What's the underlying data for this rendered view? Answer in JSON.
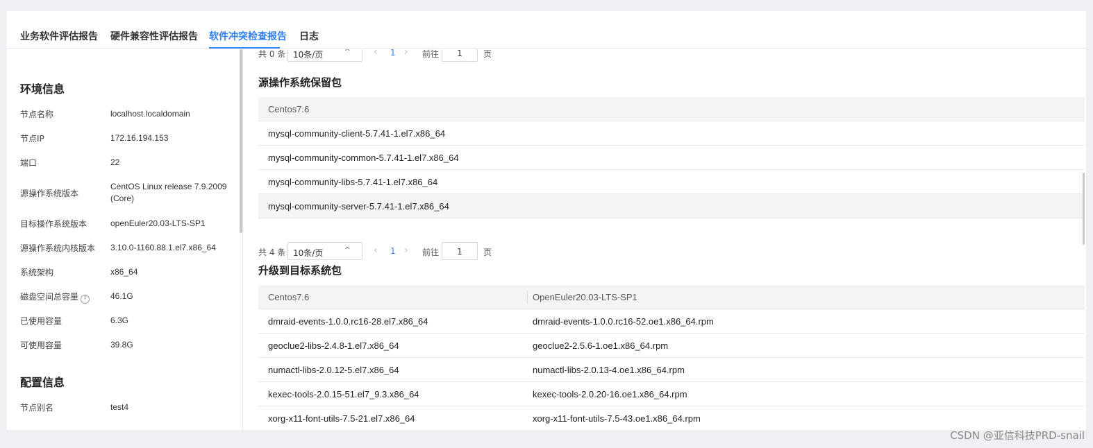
{
  "tabs": [
    {
      "label": "业务软件评估报告"
    },
    {
      "label": "硬件兼容性评估报告"
    },
    {
      "label": "软件冲突检查报告"
    },
    {
      "label": "日志"
    }
  ],
  "env": {
    "title": "环境信息",
    "rows": [
      {
        "label": "节点名称",
        "value": "localhost.localdomain"
      },
      {
        "label": "节点IP",
        "value": "172.16.194.153"
      },
      {
        "label": "端口",
        "value": "22"
      },
      {
        "label": "源操作系统版本",
        "value": "CentOS Linux release 7.9.2009 (Core)"
      },
      {
        "label": "目标操作系统版本",
        "value": "openEuler20.03-LTS-SP1"
      },
      {
        "label": "源操作系统内核版本",
        "value": "3.10.0-1160.88.1.el7.x86_64"
      },
      {
        "label": "系统架构",
        "value": "x86_64"
      },
      {
        "label": "磁盘空间总容量",
        "value": "46.1G",
        "help_icon": "?"
      },
      {
        "label": "已使用容量",
        "value": "6.3G"
      },
      {
        "label": "可使用容量",
        "value": "39.8G"
      }
    ]
  },
  "config": {
    "title": "配置信息",
    "rows": [
      {
        "label": "节点别名",
        "value": "test4"
      }
    ]
  },
  "pager_top": {
    "total": "共 0 条",
    "size": "10条/页",
    "chevron": "^",
    "prev": "‹",
    "page": "1",
    "next": "›",
    "goto": "前往",
    "goto_value": "1",
    "unit": "页"
  },
  "retained": {
    "title": "源操作系统保留包",
    "header": "Centos7.6",
    "rows": [
      "mysql-community-client-5.7.41-1.el7.x86_64",
      "mysql-community-common-5.7.41-1.el7.x86_64",
      "mysql-community-libs-5.7.41-1.el7.x86_64",
      "mysql-community-server-5.7.41-1.el7.x86_64"
    ]
  },
  "pager_mid": {
    "total": "共 4 条",
    "size": "10条/页",
    "chevron": "^",
    "prev": "‹",
    "page": "1",
    "next": "›",
    "goto": "前往",
    "goto_value": "1",
    "unit": "页"
  },
  "upgrade": {
    "title": "升级到目标系统包",
    "headers": [
      "Centos7.6",
      "OpenEuler20.03-LTS-SP1"
    ],
    "rows": [
      [
        "dmraid-events-1.0.0.rc16-28.el7.x86_64",
        "dmraid-events-1.0.0.rc16-52.oe1.x86_64.rpm"
      ],
      [
        "geoclue2-libs-2.4.8-1.el7.x86_64",
        "geoclue2-2.5.6-1.oe1.x86_64.rpm"
      ],
      [
        "numactl-libs-2.0.12-5.el7.x86_64",
        "numactl-libs-2.0.13-4.oe1.x86_64.rpm"
      ],
      [
        "kexec-tools-2.0.15-51.el7_9.3.x86_64",
        "kexec-tools-2.0.20-16.oe1.x86_64.rpm"
      ],
      [
        "xorg-x11-font-utils-7.5-21.el7.x86_64",
        "xorg-x11-font-utils-7.5-43.oe1.x86_64.rpm"
      ]
    ]
  },
  "watermark": "CSDN @亚信科技PRD-snail"
}
